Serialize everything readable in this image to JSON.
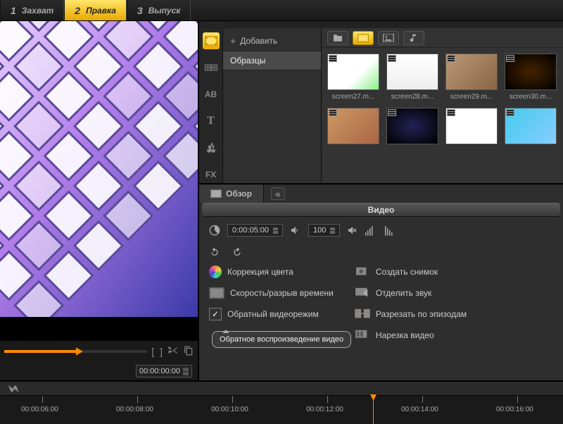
{
  "tabs": [
    {
      "num": "1",
      "label": "Захват"
    },
    {
      "num": "2",
      "label": "Правка"
    },
    {
      "num": "3",
      "label": "Выпуск"
    }
  ],
  "active_tab": 1,
  "preview_tc": "00:00:00:00",
  "tree": {
    "add": "Добавить",
    "templates": "Образцы"
  },
  "thumbs": [
    {
      "cap": "screen27.m..."
    },
    {
      "cap": "screen28.m..."
    },
    {
      "cap": "screen29.m..."
    },
    {
      "cap": "screen30.m..."
    },
    {
      "cap": ""
    },
    {
      "cap": ""
    },
    {
      "cap": ""
    },
    {
      "cap": ""
    }
  ],
  "panel": {
    "overview": "Обзор",
    "title": "Видео",
    "duration": "0:00:05:00",
    "volume": "100"
  },
  "opts": {
    "left": [
      {
        "label": "Коррекция цвета"
      },
      {
        "label": "Скорость/разрыв времени"
      },
      {
        "label": "Обратный видеорежим",
        "checked": true
      }
    ],
    "right": [
      {
        "label": "Создать снимок"
      },
      {
        "label": "Отделить звук"
      },
      {
        "label": "Разрезать по эпизодам"
      },
      {
        "label": "Нарезка видео"
      }
    ]
  },
  "tooltip": "Обратное воспроизведение видео",
  "timeline_ticks": [
    "00:00:06:00",
    "00:00:08:00",
    "00:00:10:00",
    "00:00:12:00",
    "00:00:14:00",
    "00:00:16:00"
  ]
}
